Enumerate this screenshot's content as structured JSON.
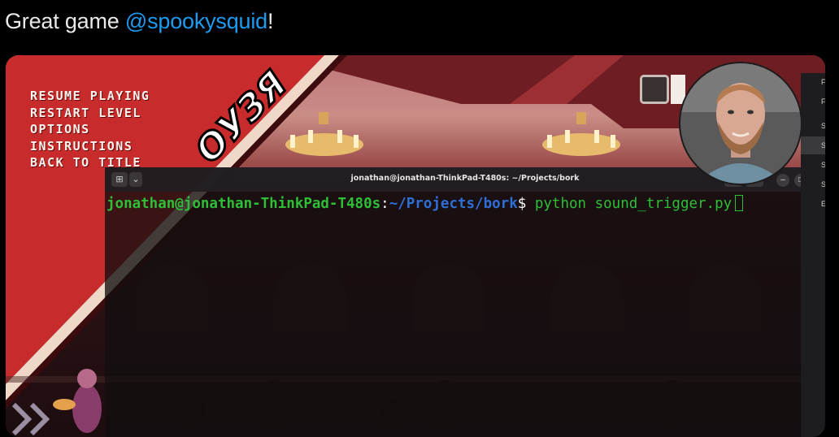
{
  "tweet": {
    "text_before": "Great game ",
    "mention": "@spookysquid",
    "text_after": "!"
  },
  "pause_menu": {
    "items": [
      "RESUME PLAYING",
      "RESTART LEVEL",
      "OPTIONS",
      "INSTRUCTIONS",
      "BACK TO TITLE"
    ]
  },
  "banner_text": "ОУЗЯ",
  "terminal": {
    "window_title": "jonathan@jonathan-ThinkPad-T480s: ~/Projects/bork",
    "prompt_user": "jonathan@jonathan-ThinkPad-T480s",
    "prompt_sep": ":",
    "prompt_path": "~/Projects/bork",
    "prompt_symbol": "$",
    "command": " python sound_trigger.py"
  },
  "side_panel": {
    "items": [
      "F",
      "F",
      "S",
      "S",
      "S",
      "S",
      "E"
    ]
  }
}
